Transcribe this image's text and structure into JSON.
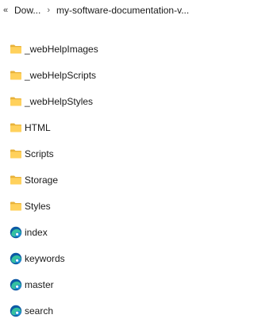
{
  "breadcrumb": {
    "overflow_icon": "chevron-double-left-icon",
    "segments": [
      "Dow...",
      "my-software-documentation-v..."
    ],
    "separator": "›"
  },
  "files": [
    {
      "name": "_webHelpImages",
      "type": "folder"
    },
    {
      "name": "_webHelpScripts",
      "type": "folder"
    },
    {
      "name": "_webHelpStyles",
      "type": "folder"
    },
    {
      "name": "HTML",
      "type": "folder"
    },
    {
      "name": "Scripts",
      "type": "folder"
    },
    {
      "name": "Storage",
      "type": "folder"
    },
    {
      "name": "Styles",
      "type": "folder"
    },
    {
      "name": "index",
      "type": "edge-html"
    },
    {
      "name": "keywords",
      "type": "edge-html"
    },
    {
      "name": "master",
      "type": "edge-html"
    },
    {
      "name": "search",
      "type": "edge-html"
    }
  ],
  "colors": {
    "folder_back": "#E8B23A",
    "folder_front": "#FFD15C",
    "edge_blue": "#0C59A4",
    "edge_teal": "#35C1A0"
  }
}
